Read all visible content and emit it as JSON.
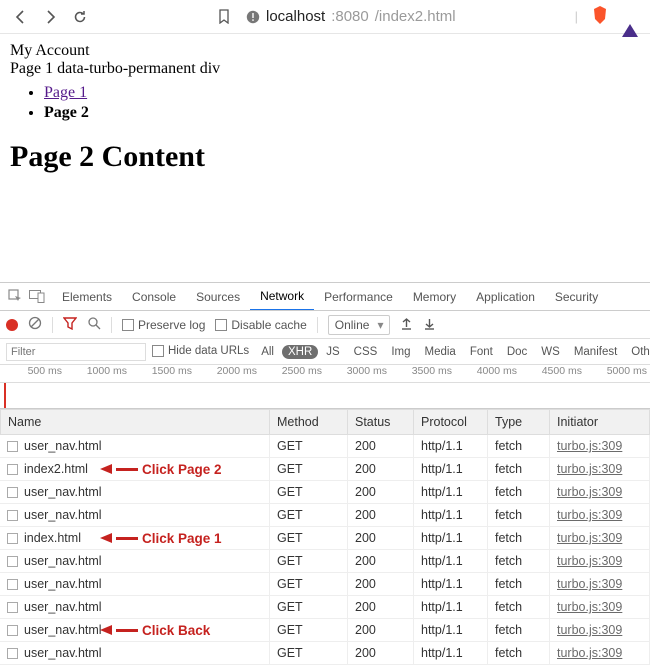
{
  "url": {
    "host": "localhost",
    "port": ":8080",
    "path": "/index2.html"
  },
  "page": {
    "account": "My Account",
    "permanent": "Page 1 data-turbo-permanent div",
    "links": [
      {
        "label": "Page 1",
        "link": true,
        "bold": false
      },
      {
        "label": "Page 2",
        "link": false,
        "bold": true
      }
    ],
    "heading": "Page 2 Content"
  },
  "devtools": {
    "tabs": [
      "Elements",
      "Console",
      "Sources",
      "Network",
      "Performance",
      "Memory",
      "Application",
      "Security"
    ],
    "active_tab": "Network",
    "bar1": {
      "preserve": "Preserve log",
      "disable_cache": "Disable cache",
      "throttle": "Online"
    },
    "bar2": {
      "filter_placeholder": "Filter",
      "hide": "Hide data URLs",
      "types": [
        "All",
        "XHR",
        "JS",
        "CSS",
        "Img",
        "Media",
        "Font",
        "Doc",
        "WS",
        "Manifest",
        "Other"
      ],
      "active_type": "XHR"
    },
    "timeline": [
      "500 ms",
      "1000 ms",
      "1500 ms",
      "2000 ms",
      "2500 ms",
      "3000 ms",
      "3500 ms",
      "4000 ms",
      "4500 ms",
      "5000 ms"
    ],
    "columns": [
      "Name",
      "Method",
      "Status",
      "Protocol",
      "Type",
      "Initiator"
    ],
    "rows": [
      {
        "name": "user_nav.html",
        "method": "GET",
        "status": "200",
        "protocol": "http/1.1",
        "type": "fetch",
        "initiator": "turbo.js:309"
      },
      {
        "name": "index2.html",
        "method": "GET",
        "status": "200",
        "protocol": "http/1.1",
        "type": "fetch",
        "initiator": "turbo.js:309"
      },
      {
        "name": "user_nav.html",
        "method": "GET",
        "status": "200",
        "protocol": "http/1.1",
        "type": "fetch",
        "initiator": "turbo.js:309"
      },
      {
        "name": "user_nav.html",
        "method": "GET",
        "status": "200",
        "protocol": "http/1.1",
        "type": "fetch",
        "initiator": "turbo.js:309"
      },
      {
        "name": "index.html",
        "method": "GET",
        "status": "200",
        "protocol": "http/1.1",
        "type": "fetch",
        "initiator": "turbo.js:309"
      },
      {
        "name": "user_nav.html",
        "method": "GET",
        "status": "200",
        "protocol": "http/1.1",
        "type": "fetch",
        "initiator": "turbo.js:309"
      },
      {
        "name": "user_nav.html",
        "method": "GET",
        "status": "200",
        "protocol": "http/1.1",
        "type": "fetch",
        "initiator": "turbo.js:309"
      },
      {
        "name": "user_nav.html",
        "method": "GET",
        "status": "200",
        "protocol": "http/1.1",
        "type": "fetch",
        "initiator": "turbo.js:309"
      },
      {
        "name": "user_nav.html",
        "method": "GET",
        "status": "200",
        "protocol": "http/1.1",
        "type": "fetch",
        "initiator": "turbo.js:309"
      },
      {
        "name": "user_nav.html",
        "method": "GET",
        "status": "200",
        "protocol": "http/1.1",
        "type": "fetch",
        "initiator": "turbo.js:309"
      }
    ],
    "annotations": [
      {
        "row": 1,
        "text": "Click Page 2"
      },
      {
        "row": 4,
        "text": "Click Page 1"
      },
      {
        "row": 8,
        "text": "Click Back"
      }
    ]
  }
}
